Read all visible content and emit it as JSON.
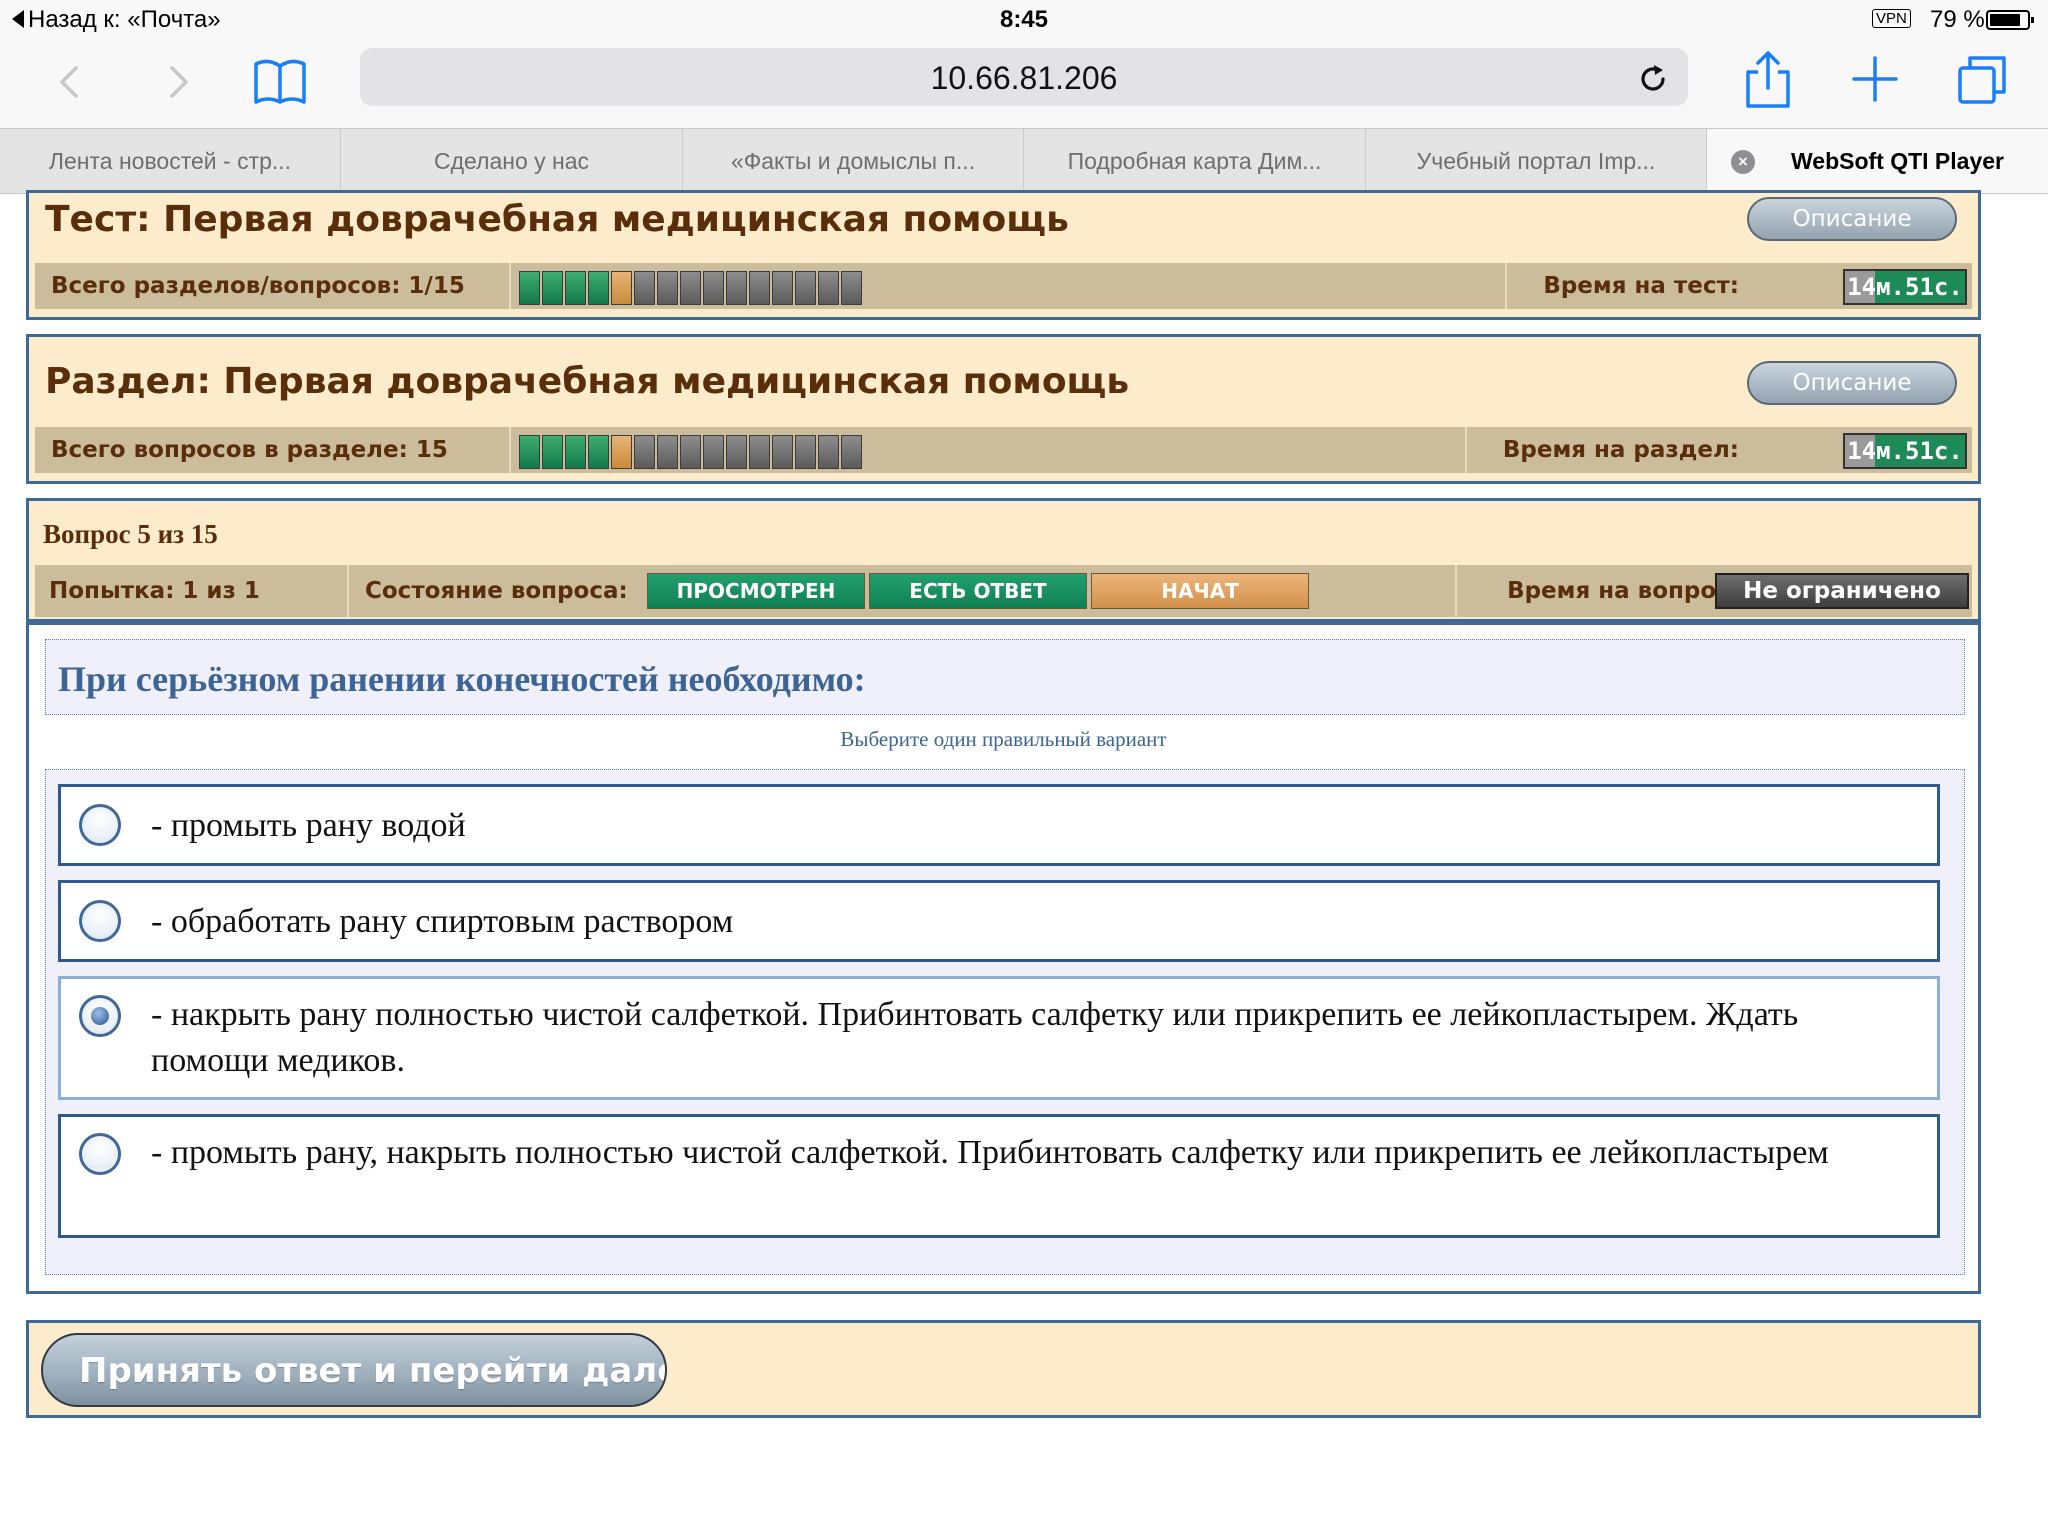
{
  "status_bar": {
    "back_label": "Назад к: «Почта»",
    "time": "8:45",
    "vpn": "VPN",
    "battery": "79 %",
    "battery_level": 0.79
  },
  "browser": {
    "url": "10.66.81.206",
    "icons": [
      "back-chevron-icon",
      "forward-chevron-icon",
      "bookmarks-book-icon",
      "reload-icon",
      "share-icon",
      "new-tab-plus-icon",
      "tabs-overview-icon"
    ],
    "tabs": [
      {
        "label": "Лента новостей - стр..."
      },
      {
        "label": "Сделано у нас"
      },
      {
        "label": "«Факты и домыслы п..."
      },
      {
        "label": "Подробная карта Дим..."
      },
      {
        "label": "Учебный портал Imp..."
      },
      {
        "label": "WebSoft QTI Player",
        "active": true
      }
    ]
  },
  "test": {
    "title": "Тест: Первая доврачебная медицинская помощь",
    "description_button": "Описание",
    "total_label": "Всего разделов/вопросов: 1/15",
    "time_label": "Время на тест:",
    "time_value": "14м.51с.",
    "progress": {
      "done": 4,
      "current": 1,
      "todo": 10
    }
  },
  "section": {
    "title": "Раздел: Первая доврачебная медицинская помощь",
    "description_button": "Описание",
    "total_label": "Всего вопросов в разделе: 15",
    "time_label": "Время на раздел:",
    "time_value": "14м.51с.",
    "progress": {
      "done": 4,
      "current": 1,
      "todo": 10
    }
  },
  "question": {
    "counter": "Вопрос 5 из 15",
    "attempt": "Попытка: 1 из 1",
    "state_label": "Состояние вопроса:",
    "states": [
      "ПРОСМОТРЕН",
      "ЕСТЬ ОТВЕТ",
      "НАЧАТ"
    ],
    "time_label": "Время на вопрос:",
    "time_value": "Не ограничено",
    "text": "При серьёзном ранении конечностей необходимо:",
    "hint": "Выберите один правильный вариант",
    "answers": [
      {
        "text": "- промыть рану водой",
        "selected": false
      },
      {
        "text": "- обработать рану спиртовым раствором",
        "selected": false
      },
      {
        "text": "- накрыть рану полностью чистой салфеткой. Прибинтовать салфетку или прикрепить ее лейкопластырем. Ждать помощи медиков.",
        "selected": true
      },
      {
        "text": "- промыть рану, накрыть полностью чистой салфеткой. Прибинтовать салфетку или прикрепить ее лейкопластырем",
        "selected": false
      }
    ]
  },
  "footer": {
    "submit_label": "Принять ответ и перейти дале"
  },
  "colors": {
    "panel_bg": "#fdeccb",
    "panel_border": "#3f6a97",
    "title_brown": "#5a2e0a",
    "question_blue": "#3c6494",
    "done_green": "#1a8f5c",
    "current_orange": "#d99a52"
  }
}
